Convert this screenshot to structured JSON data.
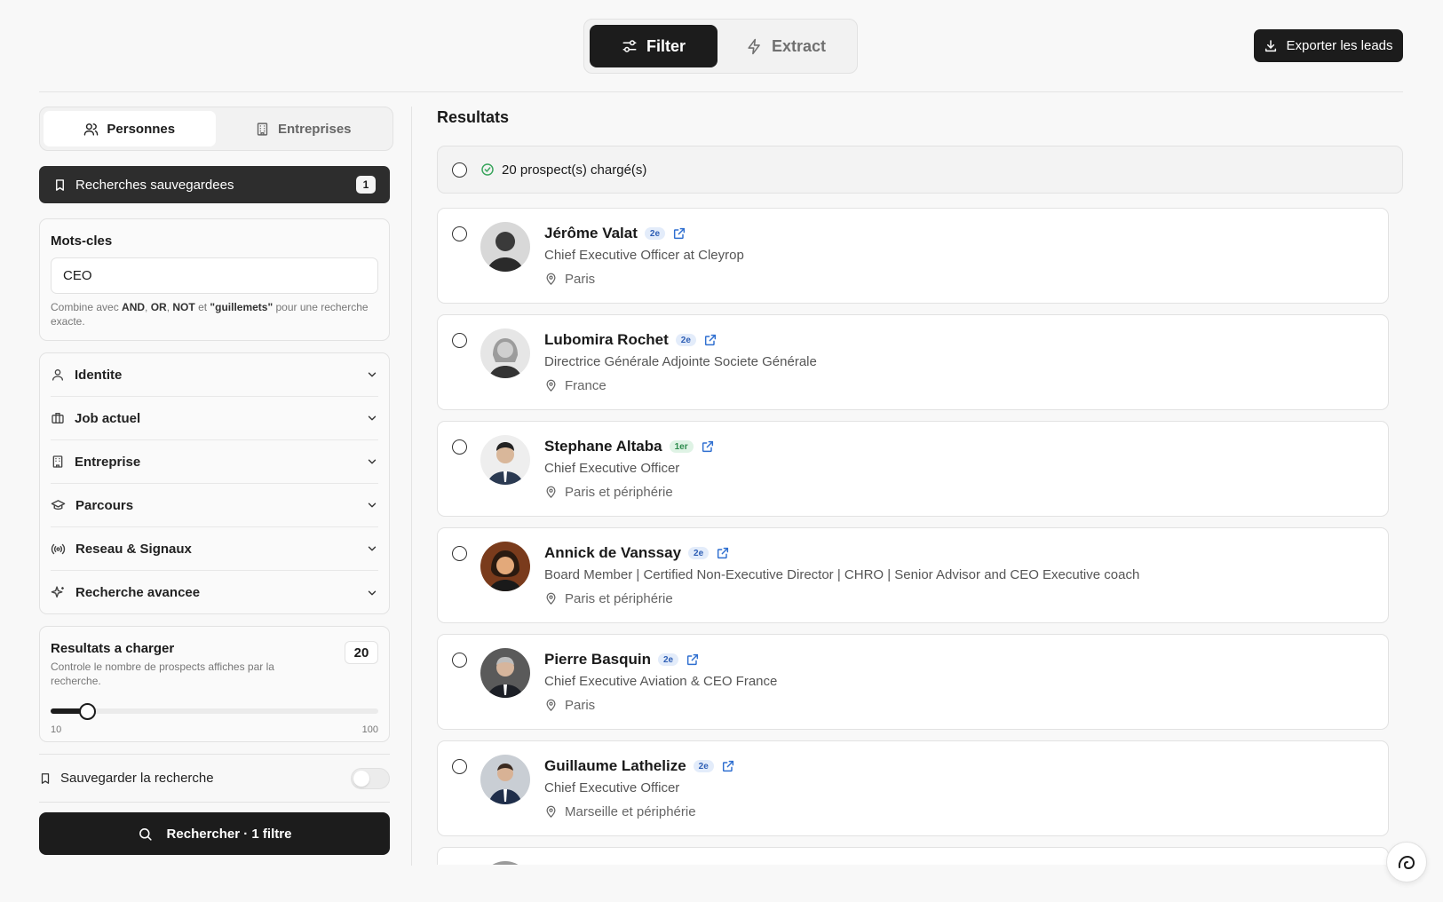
{
  "header": {
    "modes": [
      {
        "label": "Filter",
        "active": true,
        "icon": "sliders-icon"
      },
      {
        "label": "Extract",
        "active": false,
        "icon": "bolt-icon"
      }
    ],
    "export_label": "Exporter les leads"
  },
  "sidebar": {
    "tabs": [
      {
        "label": "Personnes",
        "active": true,
        "icon": "users-icon"
      },
      {
        "label": "Entreprises",
        "active": false,
        "icon": "building-icon"
      }
    ],
    "saved_searches": {
      "label": "Recherches sauvegardees",
      "count": "1"
    },
    "keywords": {
      "label": "Mots-cles",
      "value": "CEO",
      "hint_prefix": "Combine avec ",
      "hint_and": "AND",
      "hint_sep1": ", ",
      "hint_or": "OR",
      "hint_sep2": ", ",
      "hint_not": "NOT",
      "hint_mid": " et ",
      "hint_quoted": "\"guillemets\"",
      "hint_suffix": " pour une recherche exacte."
    },
    "filters": [
      {
        "label": "Identite",
        "icon": "user-icon"
      },
      {
        "label": "Job actuel",
        "icon": "briefcase-icon"
      },
      {
        "label": "Entreprise",
        "icon": "building-icon"
      },
      {
        "label": "Parcours",
        "icon": "graduation-cap-icon"
      },
      {
        "label": "Reseau & Signaux",
        "icon": "radio-icon"
      },
      {
        "label": "Recherche avancee",
        "icon": "sparkles-icon"
      }
    ],
    "load": {
      "title": "Resultats a charger",
      "description": "Controle le nombre de prospects affiches par la recherche.",
      "value": "20",
      "min_label": "10",
      "max_label": "100",
      "min": 10,
      "max": 100,
      "current": 20
    },
    "save_search_label": "Sauvegarder la recherche",
    "save_search_enabled": false,
    "search_button_label": "Rechercher · 1 filtre"
  },
  "results": {
    "title": "Resultats",
    "status": "20 prospect(s) chargé(s)",
    "people": [
      {
        "name": "Jérôme Valat",
        "degree": "2e",
        "title": "Chief Executive Officer at Cleyrop",
        "location": "Paris"
      },
      {
        "name": "Lubomira Rochet",
        "degree": "2e",
        "title": "Directrice Générale Adjointe Societe Générale",
        "location": "France"
      },
      {
        "name": "Stephane Altaba",
        "degree": "1er",
        "title": "Chief Executive Officer",
        "location": "Paris et périphérie"
      },
      {
        "name": "Annick de Vanssay",
        "degree": "2e",
        "title": "Board Member | Certified Non-Executive Director | CHRO | Senior Advisor and CEO Executive coach",
        "location": "Paris et périphérie"
      },
      {
        "name": "Pierre Basquin",
        "degree": "2e",
        "title": "Chief Executive Aviation & CEO France",
        "location": "Paris"
      },
      {
        "name": "Guillaume Lathelize",
        "degree": "2e",
        "title": "Chief Executive Officer",
        "location": "Marseille et périphérie"
      }
    ]
  },
  "colors": {
    "primary": "#1c1c1c",
    "link": "#2f6fd0",
    "success": "#3aa55d",
    "badge_second_bg": "#e3ecfa",
    "badge_first_bg": "#dff3e5"
  }
}
